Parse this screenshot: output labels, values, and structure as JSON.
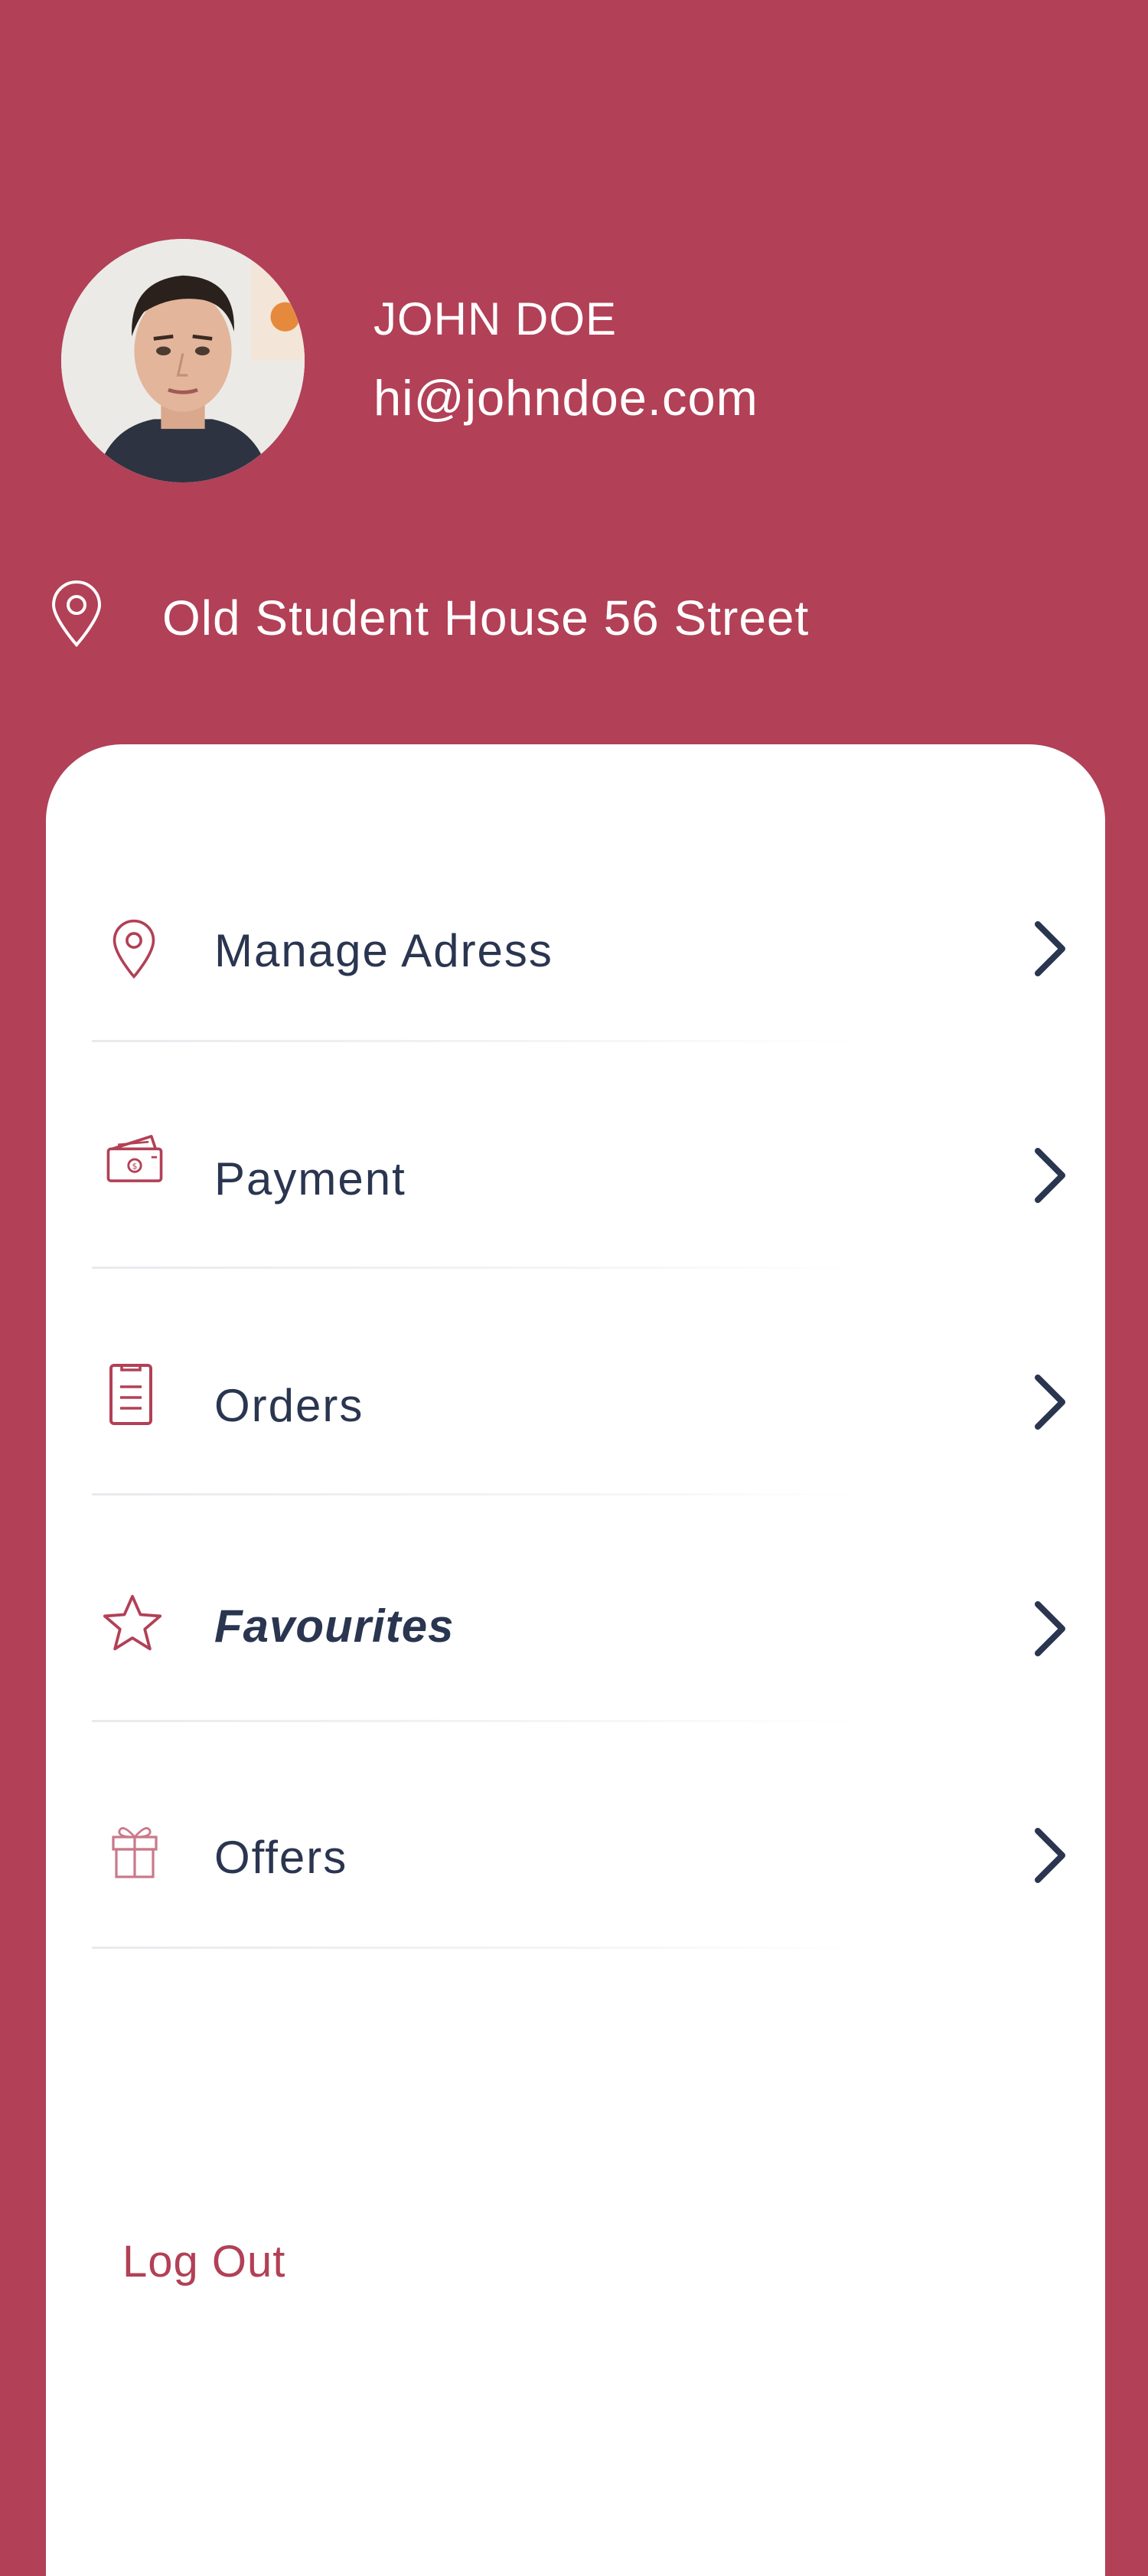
{
  "profile": {
    "name": "JOHN DOE",
    "email": "hi@johndoe.com",
    "address": "Old Student House 56 Street"
  },
  "menu": {
    "items": [
      {
        "label": "Manage Adress",
        "icon": "location-pin-icon"
      },
      {
        "label": "Payment",
        "icon": "wallet-icon"
      },
      {
        "label": "Orders",
        "icon": "document-icon"
      },
      {
        "label": "Favourites",
        "icon": "star-icon"
      },
      {
        "label": "Offers",
        "icon": "gift-icon"
      }
    ],
    "arrow_icon": "chevron-right-icon"
  },
  "logout_label": "Log Out",
  "colors": {
    "primary": "#b24056",
    "text_dark": "#2a3550",
    "card": "#ffffff"
  }
}
